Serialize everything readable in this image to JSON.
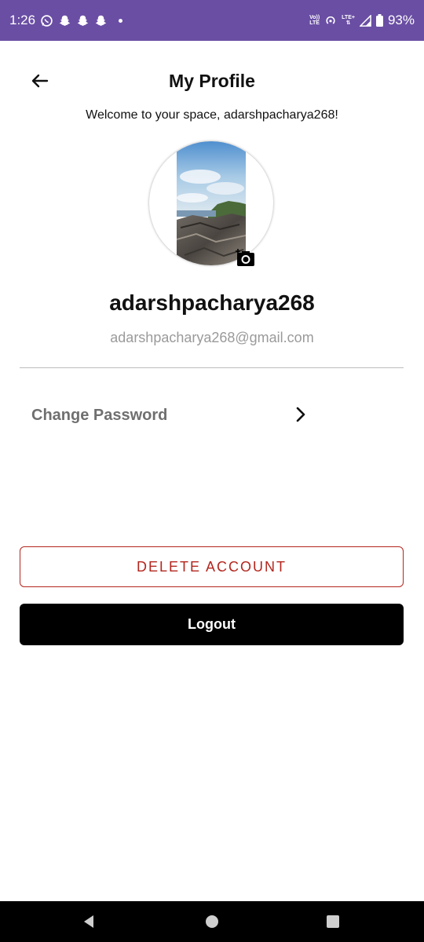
{
  "status_bar": {
    "time": "1:26",
    "network_label_top": "Vo))",
    "network_label_bottom": "LTE",
    "lte_label": "LTE+",
    "battery": "93%",
    "icons": [
      "whatsapp-icon",
      "snapchat-icon",
      "snapchat-icon",
      "snapchat-icon",
      "hotspot-icon",
      "signal-icon",
      "battery-icon"
    ]
  },
  "header": {
    "title": "My Profile",
    "back_icon": "back-arrow-icon"
  },
  "profile": {
    "welcome": "Welcome to your space, adarshpacharya268!",
    "username": "adarshpacharya268",
    "email": "adarshpacharya268@gmail.com",
    "camera_icon": "add-photo-icon"
  },
  "menu": {
    "change_password": "Change Password",
    "chevron_icon": "chevron-right-icon"
  },
  "actions": {
    "delete_account": "DELETE ACCOUNT",
    "logout": "Logout"
  },
  "colors": {
    "status_bar": "#6a4ea4",
    "danger": "#b3261e",
    "logout_bg": "#000000"
  },
  "nav_bar": {
    "icons": [
      "nav-back-icon",
      "nav-home-icon",
      "nav-recents-icon"
    ]
  }
}
